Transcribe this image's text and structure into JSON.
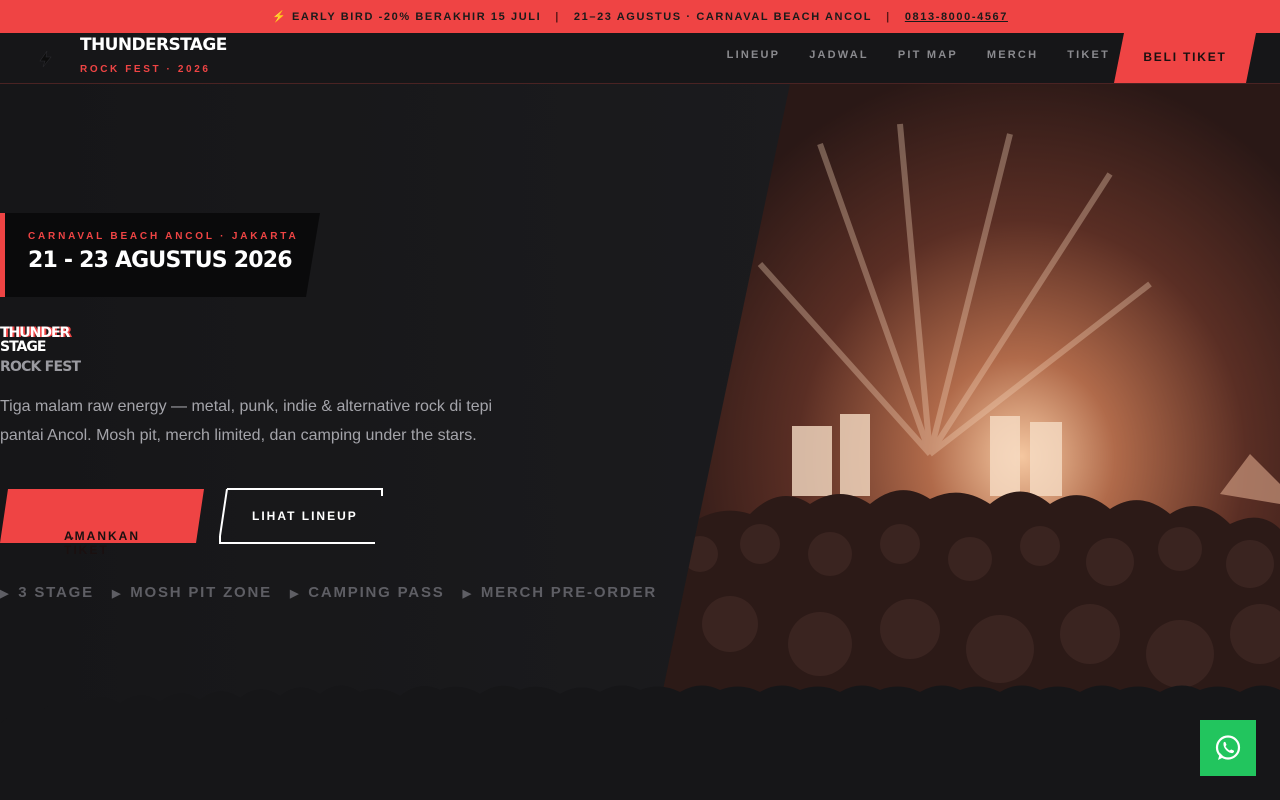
{
  "promo": {
    "bolt": "⚡",
    "offer": "EARLY BIRD -20% BERAKHIR 15 JULI",
    "separator": "|",
    "event": "21–23 AGUSTUS · CARNAVAL BEACH ANCOL",
    "phone": "0813-8000-4567"
  },
  "nav": {
    "brand": "THUNDERSTAGE",
    "brand_sub": "ROCK FEST · 2026",
    "links": [
      "LINEUP",
      "JADWAL",
      "PIT MAP",
      "MERCH",
      "TIKET"
    ],
    "cta": "BELI TIKET",
    "accent": "#ef4444"
  },
  "hero": {
    "location": "CARNAVAL BEACH ANCOL · JAKARTA",
    "dates": "21 - 23 AGUSTUS 2026",
    "title_line1": "THUNDER",
    "title_line2": "STAGE",
    "title_line3": "ROCK FEST",
    "description": "Tiga malam raw energy — metal, punk, indie & alternative rock di tepi pantai Ancol. Mosh pit, merch limited, dan camping under the stars.",
    "primary_cta": "AMANKAN TIKET",
    "primary_cta_icon": "→",
    "secondary_cta": "LIHAT LINEUP",
    "features": [
      "3 STAGE",
      "MOSH PIT ZONE",
      "CAMPING PASS",
      "MERCH PRE-ORDER"
    ],
    "feature_marker": "▶"
  },
  "icons": {
    "logo": "lightning-icon",
    "whatsapp": "whatsapp-icon"
  }
}
